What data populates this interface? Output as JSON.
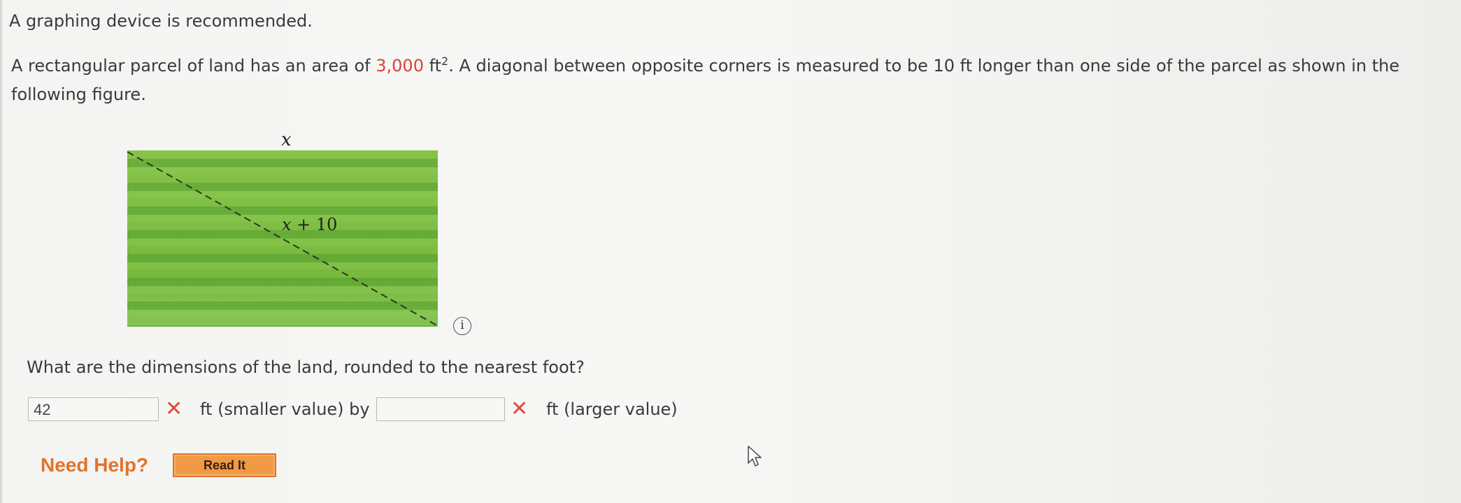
{
  "intro": "A graphing device is recommended.",
  "problem": {
    "part1": "A rectangular parcel of land has an area of ",
    "area_value": "3,000",
    "area_unit": " ft",
    "area_exp": "2",
    "part2": ". A diagonal between opposite corners is measured to be 10 ft longer than one side of the parcel as shown in the following figure."
  },
  "figure": {
    "top_label": "x",
    "diagonal_label_var": "x",
    "diagonal_label_rest": " + 10",
    "info_glyph": "i"
  },
  "question": "What are the dimensions of the land, rounded to the nearest foot?",
  "answers": {
    "first_value": "42",
    "first_status": "incorrect",
    "mid_text": "ft (smaller value) by",
    "second_value": "",
    "second_status": "incorrect",
    "end_text": "ft (larger value)",
    "wrong_mark": "✕"
  },
  "help": {
    "label": "Need Help?",
    "button": "Read It"
  },
  "colors": {
    "accent_red": "#d9443a",
    "help_orange": "#e1732a",
    "wrong_mark": "#e04a3c"
  },
  "icons": [
    "info-icon",
    "wrong-mark-icon",
    "mouse-cursor-icon"
  ]
}
